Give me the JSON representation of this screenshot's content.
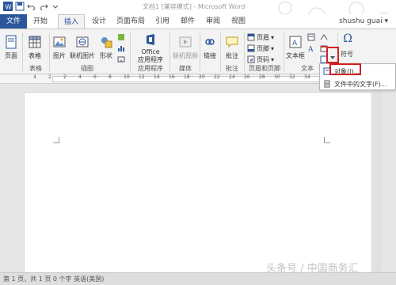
{
  "window": {
    "title": "文档1 [兼容模式] - Microsoft Word"
  },
  "tabs": {
    "file": "文件",
    "items": [
      {
        "label": "开始"
      },
      {
        "label": "插入"
      },
      {
        "label": "设计"
      },
      {
        "label": "页面布局"
      },
      {
        "label": "引用"
      },
      {
        "label": "邮件"
      },
      {
        "label": "审阅"
      },
      {
        "label": "视图"
      }
    ],
    "active": "插入"
  },
  "user": {
    "name": "shushu guai"
  },
  "ribbon": {
    "pages": {
      "label": "页面"
    },
    "tables": {
      "button": "表格",
      "group": "表格"
    },
    "illustrations": {
      "picture": "图片",
      "online_picture": "联机图片",
      "shapes": "形状",
      "group": "插图"
    },
    "apps": {
      "office": "Office",
      "app_store": "应用程序",
      "group": "应用程序"
    },
    "media": {
      "online_video": "联机视频",
      "group": "媒体"
    },
    "links": {
      "link": "链接"
    },
    "comments": {
      "comment": "批注",
      "group": "批注"
    },
    "header_footer": {
      "header": "页眉",
      "footer": "页脚",
      "page_number": "页码",
      "group": "页眉和页脚"
    },
    "text": {
      "textbox": "文本框",
      "group": "文本"
    },
    "symbols": {
      "symbol": "符号",
      "omega": "Ω"
    }
  },
  "object_menu": {
    "items": [
      {
        "label": "对象(J)..."
      },
      {
        "label": "文件中的文字(F)..."
      }
    ]
  },
  "ruler": {
    "ticks": [
      "4",
      "2",
      "2",
      "4",
      "6",
      "8",
      "10",
      "12",
      "14",
      "16",
      "18",
      "20",
      "22",
      "24",
      "26",
      "28",
      "30",
      "32",
      "34",
      "36",
      "38",
      "40"
    ]
  },
  "statusbar": {
    "text": "第 1 页，共 1 页    0 个字    英语(美国)"
  },
  "watermark": {
    "text": "头条号 / 中国商务汇"
  },
  "colors": {
    "accent": "#2b579a",
    "highlight": "#d42020"
  }
}
